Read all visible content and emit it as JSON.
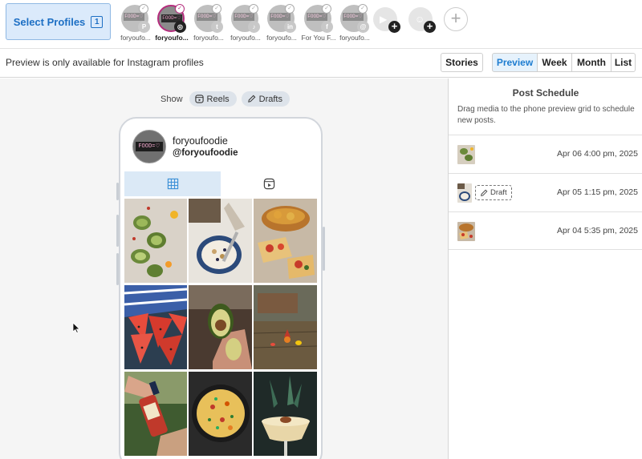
{
  "topbar": {
    "select_profiles_label": "Select Profiles",
    "selected_count": "1",
    "profiles": [
      {
        "name": "foryoufo...",
        "network": "pinterest",
        "net_glyph": "P",
        "net_color": "#c8c8c8",
        "active": false
      },
      {
        "name": "foryoufo...",
        "network": "instagram",
        "net_glyph": "◎",
        "net_color": "#222222",
        "active": true
      },
      {
        "name": "foryoufo...",
        "network": "twitter",
        "net_glyph": "t",
        "net_color": "#c8c8c8",
        "active": false
      },
      {
        "name": "foryoufo...",
        "network": "tiktok",
        "net_glyph": "♪",
        "net_color": "#c8c8c8",
        "active": false
      },
      {
        "name": "foryoufo...",
        "network": "linkedin",
        "net_glyph": "in",
        "net_color": "#c8c8c8",
        "active": false
      },
      {
        "name": "For You F...",
        "network": "facebook",
        "net_glyph": "f",
        "net_color": "#c8c8c8",
        "active": false
      },
      {
        "name": "foryoufo...",
        "network": "threads",
        "net_glyph": "@",
        "net_color": "#c8c8c8",
        "active": false
      }
    ],
    "add_networks": [
      {
        "network": "youtube",
        "glyph": "▶"
      },
      {
        "network": "snapchat",
        "glyph": "☺"
      }
    ],
    "add_profile_glyph": "+"
  },
  "toolbar": {
    "message": "Preview is only available for Instagram profiles",
    "stories_label": "Stories",
    "views": [
      "Preview",
      "Week",
      "Month",
      "List"
    ],
    "active_view": "Preview"
  },
  "preview": {
    "show_label": "Show",
    "reels_label": "Reels",
    "drafts_label": "Drafts",
    "display_name": "foryoufoodie",
    "handle": "@foryoufoodie",
    "avatar_sign": "FOOD=♡",
    "grid_images": [
      "avocado-toast-slices",
      "granola-bowl",
      "bruschetta-tomatoes",
      "watermelon-slices",
      "avocado-half-in-hand",
      "food-pins-on-bench",
      "hot-sauce-bottle",
      "frittata-skillet",
      "cocktail-with-garnish"
    ]
  },
  "schedule": {
    "title": "Post Schedule",
    "description": "Drag media to the phone preview grid to schedule new posts.",
    "posts": [
      {
        "date": "Apr 06 4:00 pm, 2025",
        "draft": false
      },
      {
        "date": "Apr 05 1:15 pm, 2025",
        "draft": true,
        "draft_label": "Draft"
      },
      {
        "date": "Apr 04 5:35 pm, 2025",
        "draft": false
      }
    ]
  },
  "colors": {
    "accent_blue": "#1d6fc4",
    "instagram_ring": "#b42d7d",
    "tab_active_bg": "#dbe9f6"
  }
}
